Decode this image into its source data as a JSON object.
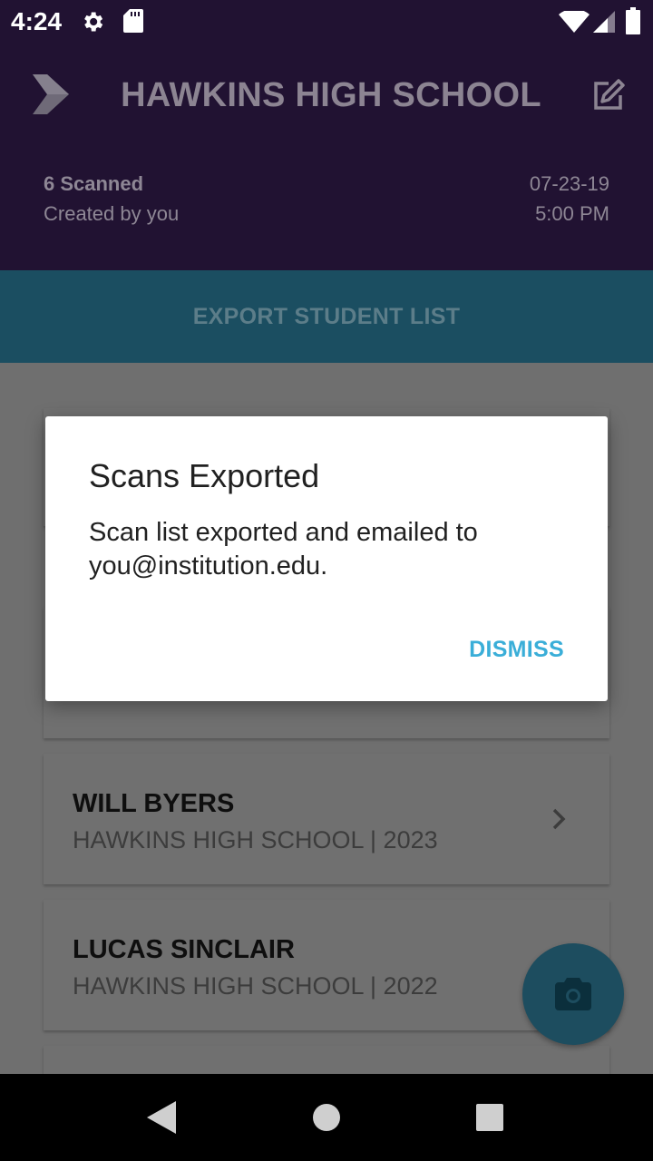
{
  "status_bar": {
    "time": "4:24"
  },
  "header": {
    "title": "HAWKINS HIGH SCHOOL",
    "scanned": "6 Scanned",
    "created_by": "Created by you",
    "date": "07-23-19",
    "time": "5:00 PM"
  },
  "export_button": {
    "label": "EXPORT STUDENT LIST"
  },
  "students": [
    {
      "name": "WILL BYERS",
      "school": "HAWKINS HIGH SCHOOL | 2023"
    },
    {
      "name": "LUCAS SINCLAIR",
      "school": "HAWKINS HIGH SCHOOL | 2022"
    }
  ],
  "dialog": {
    "title": "Scans Exported",
    "message": "Scan list exported and emailed to you@institution.edu.",
    "dismiss_label": "DISMISS"
  },
  "colors": {
    "header_bg": "#211232",
    "export_bg": "#1b4e61",
    "accent": "#3aaed8",
    "fab_bg": "#1d4d5f"
  }
}
